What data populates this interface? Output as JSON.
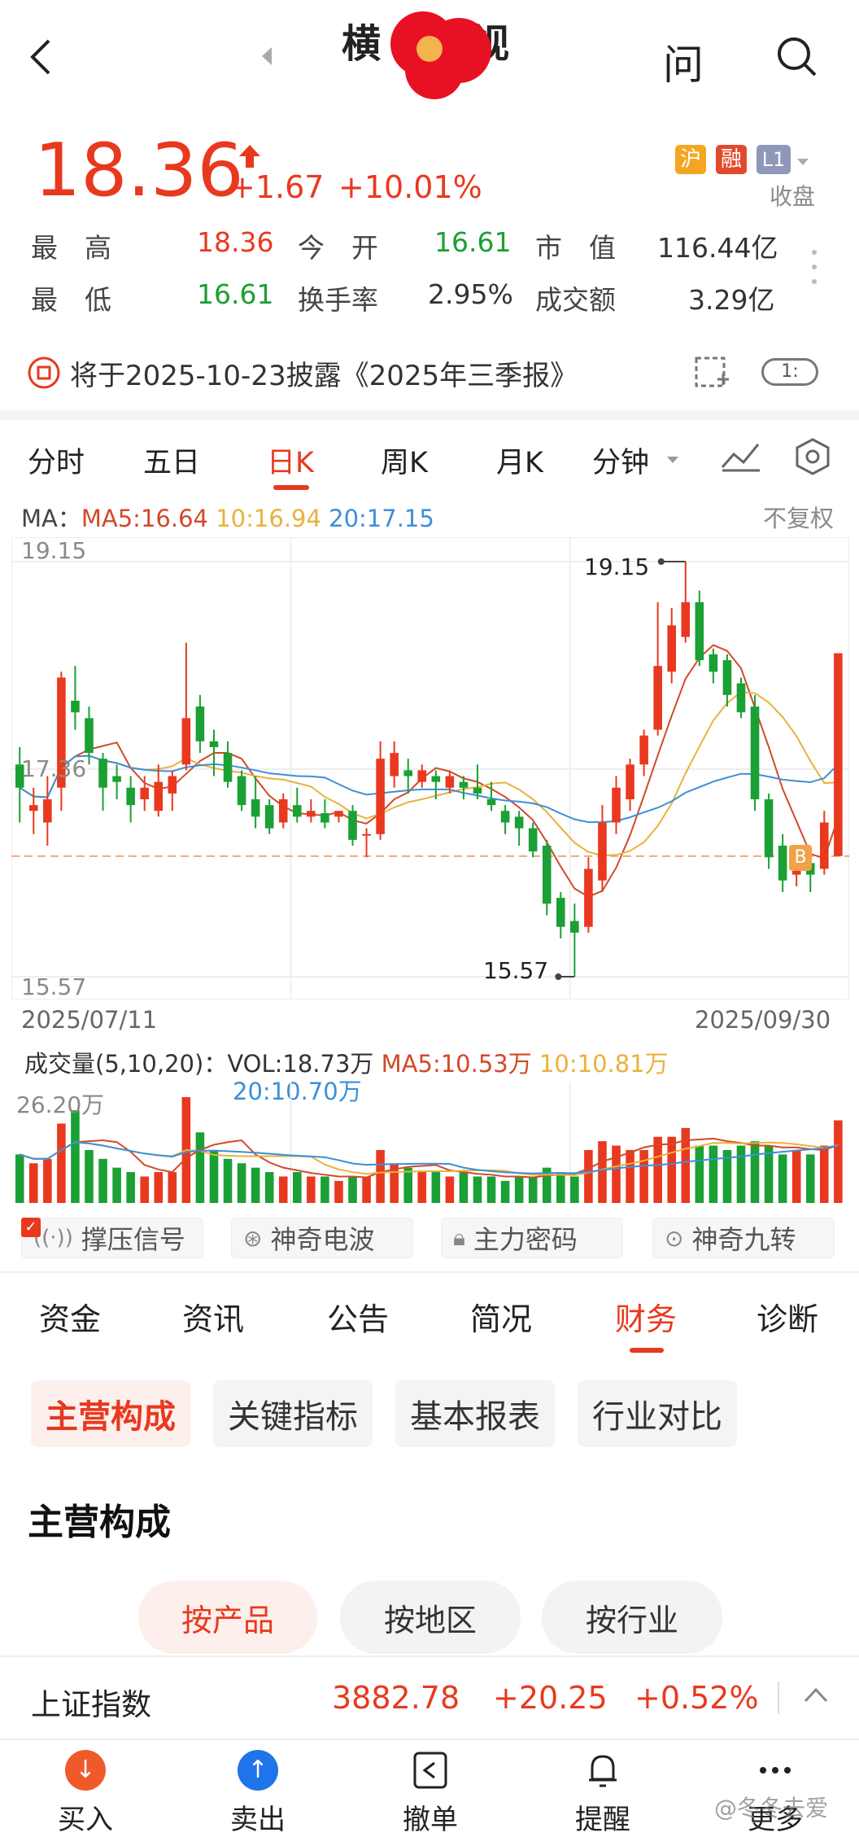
{
  "header": {
    "title_left": "横",
    "title_right": "视",
    "ask_label": "问"
  },
  "quote": {
    "price": "18.36",
    "change": "+1.67",
    "change_pct": "+10.01%",
    "tags": [
      "沪",
      "融",
      "L1"
    ],
    "status": "收盘",
    "stats": [
      {
        "label": "最　高",
        "value": "18.36",
        "color": "#e8391f"
      },
      {
        "label": "今　开",
        "value": "16.61",
        "color": "#1aa034"
      },
      {
        "label": "市　值",
        "value": "116.44亿",
        "color": "#333333"
      },
      {
        "label": "最　低",
        "value": "16.61",
        "color": "#1aa034"
      },
      {
        "label": "换手率",
        "value": "2.95%",
        "color": "#333333"
      },
      {
        "label": "成交额",
        "value": "3.29亿",
        "color": "#333333"
      }
    ]
  },
  "notice": {
    "text": "将于2025-10-23披露《2025年三季报》",
    "ratio": "1:"
  },
  "chart_tabs": [
    "分时",
    "五日",
    "日K",
    "周K",
    "月K",
    "分钟"
  ],
  "active_chart_tab": "日K",
  "ma_line": {
    "label": "MA：",
    "ma5": "MA5:16.64",
    "ma10": "10:16.94",
    "ma20": "20:17.15",
    "adjust": "不复权"
  },
  "kline": {
    "y_top": "19.15",
    "y_mid": "17.36",
    "y_bottom": "15.57",
    "high_mark": "19.15",
    "low_mark": "15.57",
    "date_start": "2025/07/11",
    "date_end": "2025/09/30",
    "b_marker": "B"
  },
  "volume": {
    "label": "成交量(5,10,20)：VOL:18.73万",
    "ma5": "MA5:10.53万",
    "ma10": "10:10.81万",
    "ma20": "20:10.70万",
    "y_top": "26.20万"
  },
  "indicators": [
    "撑压信号",
    "神奇电波",
    "主力密码",
    "神奇九转"
  ],
  "section_tabs": [
    "资金",
    "资讯",
    "公告",
    "简况",
    "财务",
    "诊断"
  ],
  "active_section_tab": "财务",
  "fin_tabs": [
    "主营构成",
    "关键指标",
    "基本报表",
    "行业对比"
  ],
  "section_title": "主营构成",
  "breakdown_tabs": [
    "按产品",
    "按地区",
    "按行业"
  ],
  "index_bar": {
    "name": "上证指数",
    "value": "3882.78",
    "change": "+20.25",
    "pct": "+0.52%"
  },
  "bottom_nav": [
    "买入",
    "卖出",
    "撤单",
    "提醒",
    "更多"
  ],
  "watermark": "@冬冬去爱",
  "colors": {
    "up": "#e8391f",
    "down": "#1aa034",
    "ma5": "#d2492a",
    "ma10": "#e8b23c",
    "ma20": "#3b8fd9",
    "accent": "#e8391f"
  },
  "chart_data": {
    "type": "candlestick",
    "ylim": [
      15.57,
      19.15
    ],
    "candles": [
      [
        17.4,
        17.2,
        17.55,
        16.9
      ],
      [
        17.0,
        17.05,
        17.2,
        16.8
      ],
      [
        16.9,
        17.1,
        17.3,
        16.7
      ],
      [
        17.2,
        18.15,
        18.2,
        17.0
      ],
      [
        17.95,
        17.85,
        18.25,
        17.7
      ],
      [
        17.8,
        17.5,
        17.9,
        17.4
      ],
      [
        17.45,
        17.2,
        17.5,
        17.0
      ],
      [
        17.3,
        17.25,
        17.4,
        17.1
      ],
      [
        17.2,
        17.05,
        17.3,
        16.9
      ],
      [
        17.1,
        17.2,
        17.3,
        17.0
      ],
      [
        17.0,
        17.25,
        17.4,
        16.95
      ],
      [
        17.15,
        17.3,
        17.35,
        17.0
      ],
      [
        17.4,
        17.8,
        18.45,
        17.35
      ],
      [
        17.9,
        17.6,
        18.0,
        17.5
      ],
      [
        17.6,
        17.55,
        17.7,
        17.3
      ],
      [
        17.5,
        17.25,
        17.6,
        17.2
      ],
      [
        17.3,
        17.05,
        17.35,
        17.0
      ],
      [
        17.1,
        16.95,
        17.3,
        16.85
      ],
      [
        17.05,
        16.85,
        17.1,
        16.8
      ],
      [
        16.9,
        17.1,
        17.15,
        16.85
      ],
      [
        17.05,
        16.95,
        17.2,
        16.9
      ],
      [
        16.95,
        17.0,
        17.1,
        16.9
      ],
      [
        16.98,
        16.9,
        17.1,
        16.85
      ],
      [
        16.95,
        17.0,
        17.0,
        16.9
      ],
      [
        17.0,
        16.75,
        17.05,
        16.7
      ],
      [
        16.8,
        16.8,
        16.85,
        16.6
      ],
      [
        16.8,
        17.45,
        17.6,
        16.75
      ],
      [
        17.3,
        17.5,
        17.6,
        17.2
      ],
      [
        17.35,
        17.3,
        17.45,
        17.15
      ],
      [
        17.25,
        17.35,
        17.4,
        17.2
      ],
      [
        17.3,
        17.25,
        17.35,
        17.1
      ],
      [
        17.2,
        17.3,
        17.35,
        17.15
      ],
      [
        17.25,
        17.2,
        17.3,
        17.1
      ],
      [
        17.2,
        17.15,
        17.4,
        17.1
      ],
      [
        17.1,
        17.05,
        17.25,
        17.0
      ],
      [
        17.0,
        16.9,
        17.05,
        16.8
      ],
      [
        16.95,
        16.85,
        17.0,
        16.7
      ],
      [
        16.85,
        16.65,
        16.9,
        16.6
      ],
      [
        16.7,
        16.2,
        16.75,
        16.1
      ],
      [
        16.25,
        16.0,
        16.3,
        15.9
      ],
      [
        16.05,
        15.95,
        16.2,
        15.57
      ],
      [
        16.0,
        16.5,
        16.6,
        15.95
      ],
      [
        16.4,
        16.9,
        17.05,
        16.3
      ],
      [
        16.9,
        17.2,
        17.3,
        16.8
      ],
      [
        17.1,
        17.4,
        17.45,
        17.0
      ],
      [
        17.4,
        17.65,
        17.7,
        17.3
      ],
      [
        17.7,
        18.25,
        18.8,
        17.65
      ],
      [
        18.2,
        18.6,
        18.75,
        18.1
      ],
      [
        18.5,
        18.8,
        19.15,
        18.45
      ],
      [
        18.8,
        18.3,
        18.9,
        18.25
      ],
      [
        18.35,
        18.2,
        18.4,
        18.1
      ],
      [
        18.3,
        18.0,
        18.35,
        17.9
      ],
      [
        18.1,
        17.85,
        18.15,
        17.8
      ],
      [
        17.9,
        17.1,
        18.0,
        17.0
      ],
      [
        17.1,
        16.6,
        17.15,
        16.5
      ],
      [
        16.7,
        16.4,
        16.8,
        16.3
      ],
      [
        16.45,
        16.6,
        16.7,
        16.35
      ],
      [
        16.55,
        16.45,
        16.65,
        16.3
      ],
      [
        16.5,
        16.9,
        17.0,
        16.45
      ],
      [
        16.61,
        18.36,
        18.36,
        16.61
      ]
    ],
    "volume": [
      11,
      9,
      10,
      18,
      21,
      12,
      10,
      8,
      7,
      6,
      7,
      7,
      24,
      16,
      12,
      10,
      9,
      8,
      7,
      6,
      7,
      6,
      6,
      5,
      6,
      6,
      12,
      9,
      8,
      7,
      7,
      6,
      7,
      6,
      6,
      5,
      6,
      6,
      8,
      7,
      6,
      12,
      14,
      13,
      12,
      12,
      15,
      15,
      17,
      13,
      13,
      12,
      13,
      14,
      13,
      11,
      12,
      11,
      13,
      18.73
    ],
    "ma_lines": {
      "ma5": "red-orange",
      "ma10": "yellow",
      "ma20": "blue"
    }
  }
}
